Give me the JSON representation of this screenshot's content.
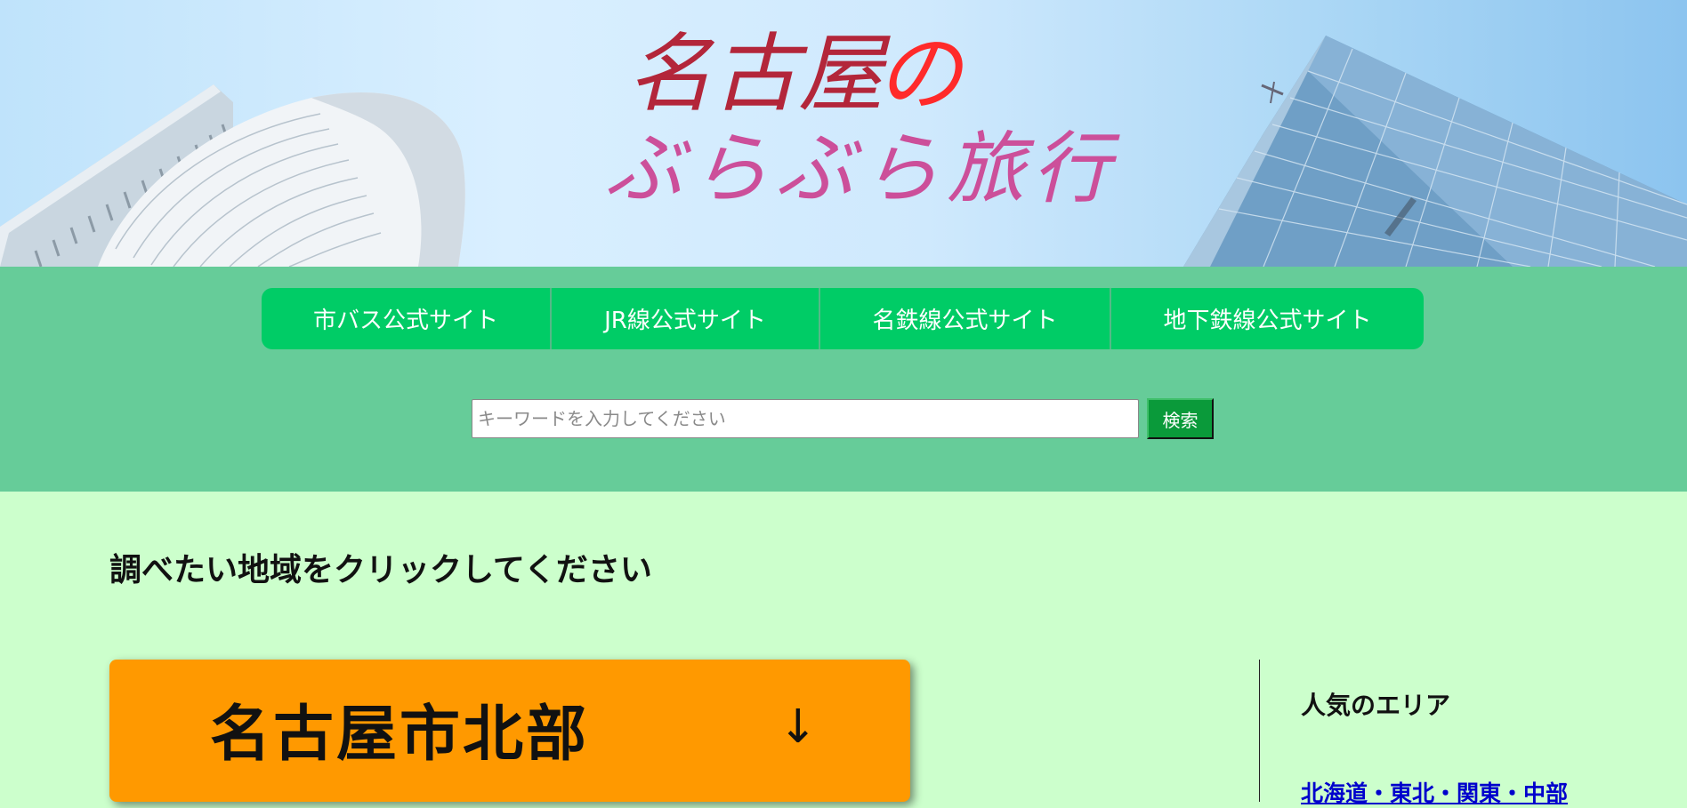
{
  "hero": {
    "logo_line1_a": "名古屋",
    "logo_line1_b": "の",
    "logo_line2": "ぶらぶら旅行",
    "colors": {
      "logo_dark": "#b3263a",
      "logo_red": "#ff2a2a",
      "logo_pink": "#cc4f9a"
    }
  },
  "nav": {
    "items": [
      {
        "label": "市バス公式サイト"
      },
      {
        "label": "JR線公式サイト"
      },
      {
        "label": "名鉄線公式サイト"
      },
      {
        "label": "地下鉄線公式サイト"
      }
    ]
  },
  "search": {
    "placeholder": "キーワードを入力してください",
    "value": "",
    "button_label": "検索"
  },
  "main": {
    "heading": "調べたい地域をクリックしてください",
    "region_card": {
      "title": "名古屋市北部",
      "arrow": "↓"
    }
  },
  "sidebar": {
    "heading": "人気のエリア",
    "link": "北海道・東北・関東・中部"
  },
  "colors": {
    "page_bg": "#ccffcc",
    "band_bg": "#66cc99",
    "nav_bg": "#00cc66",
    "search_button_bg": "#0a9a3a",
    "card_bg": "#ff9900",
    "link": "#0000cc"
  }
}
